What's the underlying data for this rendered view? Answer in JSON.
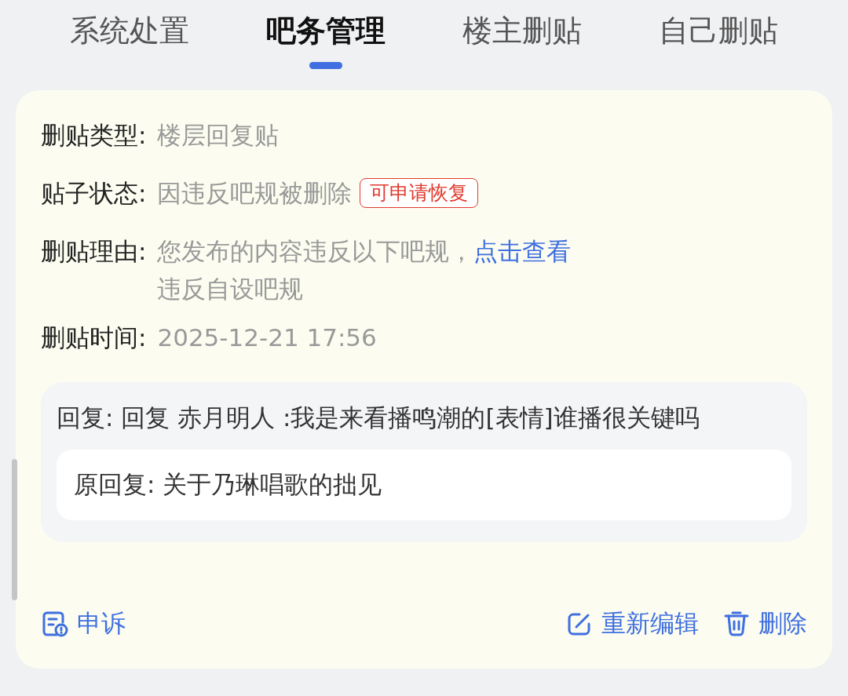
{
  "tabs": [
    {
      "label": "系统处置",
      "selected": false
    },
    {
      "label": "吧务管理",
      "selected": true
    },
    {
      "label": "楼主删贴",
      "selected": false
    },
    {
      "label": "自己删贴",
      "selected": false
    }
  ],
  "fields": [
    {
      "label": "删贴类型:",
      "value": "楼层回复贴"
    },
    {
      "label": "贴子状态:",
      "value": "因违反吧规被删除",
      "tag": "可申请恢复"
    },
    {
      "label": "删贴理由:",
      "value": "您发布的内容违反以下吧规，",
      "link": "点击查看",
      "note": "违反自设吧规"
    },
    {
      "label": "删贴时间:",
      "value": "2025-12-21 17:56"
    }
  ],
  "reply": {
    "text": "回复: 回复 赤月明人 :我是来看播鸣潮的[表情]谁播很关键吗",
    "original": "原回复: 关于乃琳唱歌的拙见"
  },
  "actions": [
    {
      "kind": "appeal",
      "label": "申诉"
    },
    {
      "kind": "edit",
      "label": "重新编辑"
    },
    {
      "kind": "delete",
      "label": "删除"
    }
  ]
}
